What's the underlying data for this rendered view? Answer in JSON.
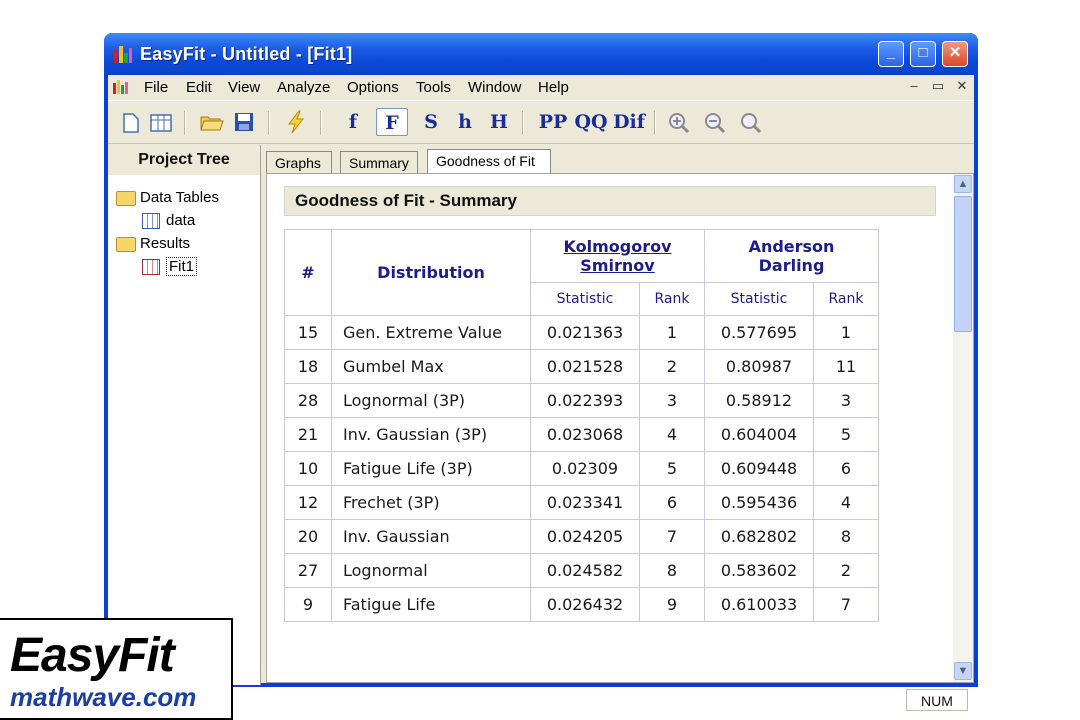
{
  "window": {
    "title": "EasyFit  -  Untitled - [Fit1]"
  },
  "menu": [
    "File",
    "Edit",
    "View",
    "Analyze",
    "Options",
    "Tools",
    "Window",
    "Help"
  ],
  "toolbar": {
    "f": "f",
    "F": "F",
    "S": "S",
    "h": "h",
    "H": "H",
    "PP": "PP",
    "QQ": "QQ",
    "Dif": "Dif"
  },
  "tree": {
    "header": "Project Tree",
    "data_tables": "Data Tables",
    "data": "data",
    "results": "Results",
    "fit1": "Fit1"
  },
  "tabs": [
    "Graphs",
    "Summary",
    "Goodness of Fit"
  ],
  "content": {
    "summary_title": "Goodness of Fit - Summary",
    "table": {
      "headers": {
        "num": "#",
        "distribution": "Distribution",
        "ks_line1": "Kolmogorov",
        "ks_line2": "Smirnov",
        "ad_line1": "Anderson",
        "ad_line2": "Darling",
        "statistic": "Statistic",
        "rank": "Rank"
      },
      "rows": [
        {
          "num": "15",
          "dist": "Gen. Extreme Value",
          "ks_stat": "0.021363",
          "ks_rank": "1",
          "ad_stat": "0.577695",
          "ad_rank": "1"
        },
        {
          "num": "18",
          "dist": "Gumbel Max",
          "ks_stat": "0.021528",
          "ks_rank": "2",
          "ad_stat": "0.80987",
          "ad_rank": "11"
        },
        {
          "num": "28",
          "dist": "Lognormal (3P)",
          "ks_stat": "0.022393",
          "ks_rank": "3",
          "ad_stat": "0.58912",
          "ad_rank": "3"
        },
        {
          "num": "21",
          "dist": "Inv. Gaussian (3P)",
          "ks_stat": "0.023068",
          "ks_rank": "4",
          "ad_stat": "0.604004",
          "ad_rank": "5"
        },
        {
          "num": "10",
          "dist": "Fatigue Life (3P)",
          "ks_stat": "0.02309",
          "ks_rank": "5",
          "ad_stat": "0.609448",
          "ad_rank": "6"
        },
        {
          "num": "12",
          "dist": "Frechet (3P)",
          "ks_stat": "0.023341",
          "ks_rank": "6",
          "ad_stat": "0.595436",
          "ad_rank": "4"
        },
        {
          "num": "20",
          "dist": "Inv. Gaussian",
          "ks_stat": "0.024205",
          "ks_rank": "7",
          "ad_stat": "0.682802",
          "ad_rank": "8"
        },
        {
          "num": "27",
          "dist": "Lognormal",
          "ks_stat": "0.024582",
          "ks_rank": "8",
          "ad_stat": "0.583602",
          "ad_rank": "2"
        },
        {
          "num": "9",
          "dist": "Fatigue Life",
          "ks_stat": "0.026432",
          "ks_rank": "9",
          "ad_stat": "0.610033",
          "ad_rank": "7"
        }
      ]
    }
  },
  "status": {
    "num": "NUM"
  },
  "logo": {
    "main": "EasyFit",
    "sub": "mathwave.com"
  }
}
